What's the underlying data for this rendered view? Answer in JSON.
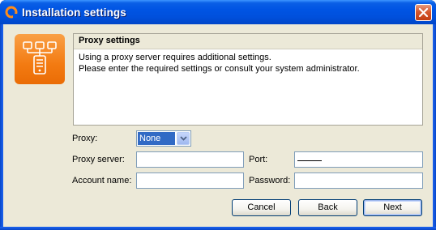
{
  "window": {
    "title": "Installation settings"
  },
  "panel": {
    "title": "Proxy settings",
    "line1": "Using a proxy server requires additional settings.",
    "line2": "Please enter the required settings or consult your system administrator."
  },
  "form": {
    "proxy_label": "Proxy:",
    "proxy_value": "None",
    "server_label": "Proxy server:",
    "server_value": "",
    "port_label": "Port:",
    "port_value": "",
    "account_label": "Account name:",
    "account_value": "",
    "password_label": "Password:",
    "password_value": ""
  },
  "buttons": {
    "cancel": "Cancel",
    "back": "Back",
    "next": "Next"
  },
  "icons": {
    "app": "app-logo-icon",
    "close": "close-icon",
    "network": "network-proxy-icon",
    "dropdown": "chevron-down-icon"
  },
  "colors": {
    "titlebar": "#0054e3",
    "accent": "#f37b12",
    "selection": "#316ac5",
    "dialog_bg": "#ece9d8"
  }
}
